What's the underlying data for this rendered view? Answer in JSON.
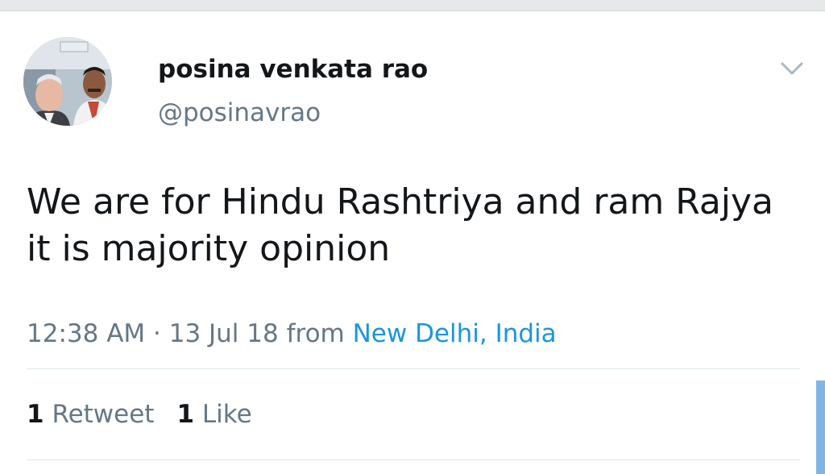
{
  "tweet": {
    "author": {
      "name": "posina venkata rao",
      "handle": "@posinavrao",
      "avatar_icon": "profile-photo"
    },
    "menu_icon": "chevron-down-icon",
    "text": "We are for Hindu Rashtriya and ram Rajya it is majority opinion",
    "time": "12:38 AM",
    "separator": " · ",
    "date": "13 Jul 18",
    "from_label": " from ",
    "location": "New Delhi, India",
    "stats": {
      "retweets_count": "1",
      "retweets_label": "Retweet",
      "likes_count": "1",
      "likes_label": "Like"
    }
  },
  "colors": {
    "text_primary": "#14171a",
    "text_secondary": "#657786",
    "link": "#1b95e0",
    "divider": "#e1e8ed"
  }
}
